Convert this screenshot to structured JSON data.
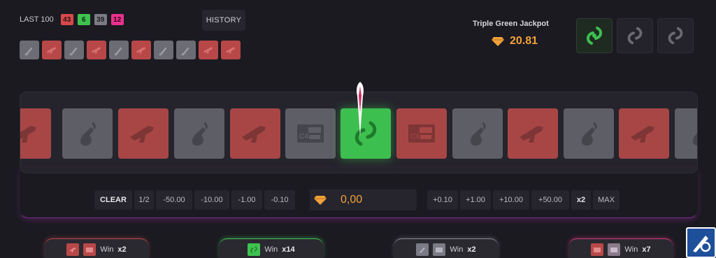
{
  "header": {
    "last100_label": "LAST 100",
    "counts": [
      {
        "value": "43",
        "color": "red"
      },
      {
        "value": "6",
        "color": "green"
      },
      {
        "value": "39",
        "color": "grey"
      },
      {
        "value": "12",
        "color": "pink"
      }
    ],
    "history_label": "HISTORY",
    "recent": [
      "grey-knife",
      "red-gun",
      "grey-knife",
      "red-gun",
      "grey-knife",
      "red-gun",
      "grey-knife",
      "grey-knife",
      "red-gun",
      "red-gun"
    ]
  },
  "jackpot": {
    "title": "Triple Green Jackpot",
    "amount": "20.81",
    "slots": [
      "green-active",
      "grey",
      "grey"
    ]
  },
  "reel": {
    "tiles": [
      "red-gun",
      "grey-molotov",
      "red-gun",
      "grey-molotov",
      "red-gun",
      "grey-c4",
      "green-swirl",
      "red-c4",
      "grey-molotov",
      "red-gun",
      "grey-molotov",
      "red-gun",
      "grey-molotov"
    ]
  },
  "controls": {
    "clear": "CLEAR",
    "half": "1/2",
    "minus": [
      "-50.00",
      "-10.00",
      "-1.00",
      "-0.10"
    ],
    "bet_value": "0,00",
    "plus": [
      "+0.10",
      "+1.00",
      "+10.00",
      "+50.00"
    ],
    "double": "x2",
    "max": "MAX"
  },
  "bets": [
    {
      "label": "Win",
      "mult": "x2",
      "color": "red"
    },
    {
      "label": "Win",
      "mult": "x14",
      "color": "green"
    },
    {
      "label": "Win",
      "mult": "x2",
      "color": "grey"
    },
    {
      "label": "Win",
      "mult": "x7",
      "color": "pink"
    }
  ],
  "colors": {
    "background": "#1b1a21",
    "red": "#a84646",
    "green": "#3cbf4f",
    "grey": "#5e5e66",
    "accent_orange": "#f2a23a",
    "pink": "#e8318c"
  }
}
